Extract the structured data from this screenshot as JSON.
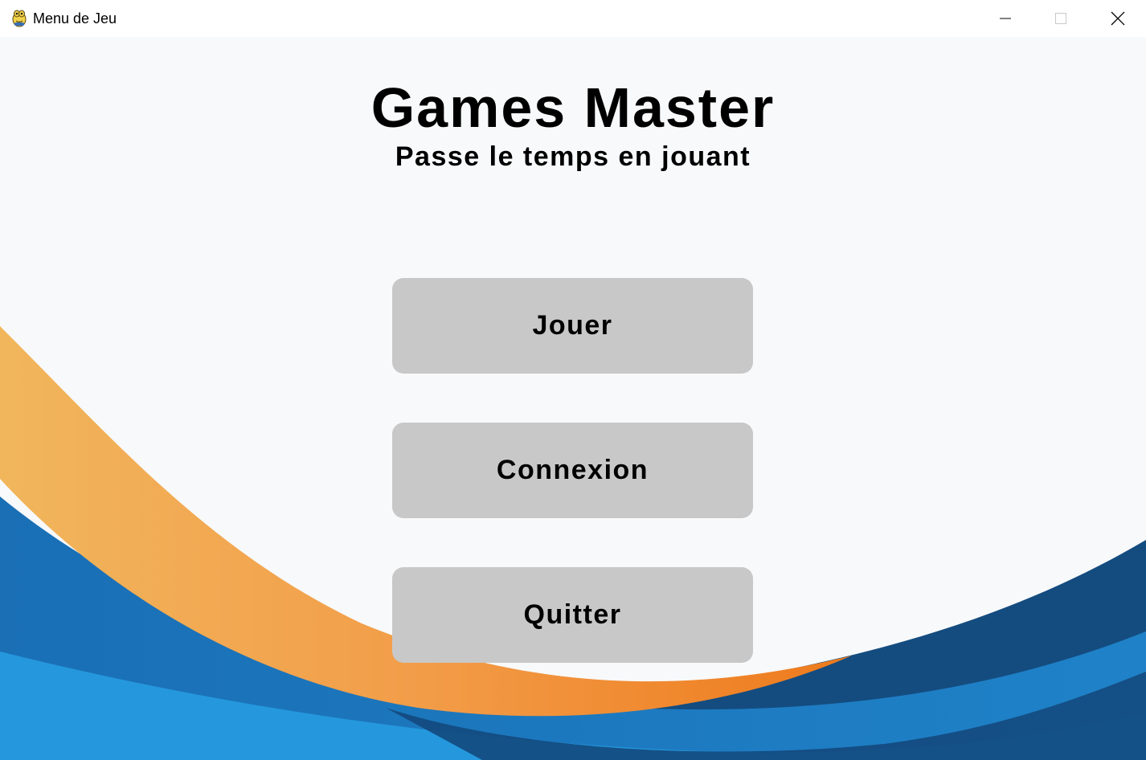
{
  "window": {
    "title": "Menu de Jeu",
    "app_icon": "python-snake-icon",
    "controls": [
      "minimize-icon",
      "maximize-icon",
      "close-icon"
    ]
  },
  "header": {
    "title": "Games Master",
    "subtitle": "Passe le temps en jouant"
  },
  "menu": {
    "play_label": "Jouer",
    "login_label": "Connexion",
    "quit_label": "Quitter"
  },
  "colors": {
    "background": "#f8f9fa",
    "button": "#c8c8c8",
    "wave_orange": "#f08a2a",
    "wave_orange_light": "#f1b65c",
    "wave_blue": "#1f78c0",
    "wave_blue_light": "#2598dd",
    "wave_navy": "#134b80"
  }
}
